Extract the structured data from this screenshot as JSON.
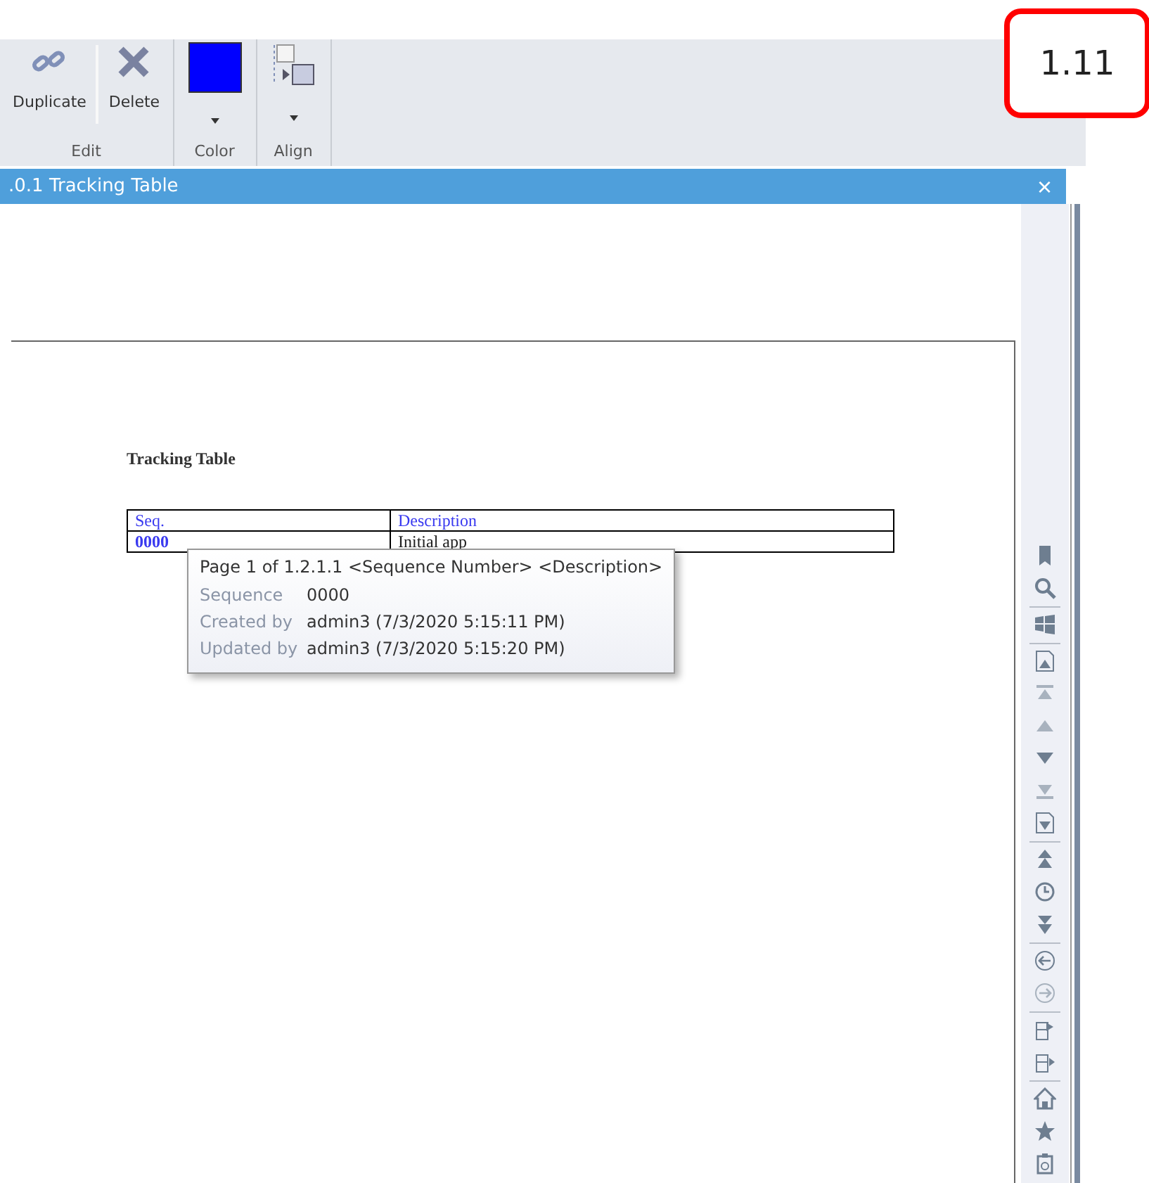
{
  "ribbon": {
    "groups": [
      {
        "kind": "buttons",
        "label": "Edit",
        "buttons": [
          {
            "label": "Duplicate"
          },
          {
            "label": "Delete"
          }
        ]
      },
      {
        "kind": "color",
        "label": "Color",
        "color": "#0000ff"
      },
      {
        "kind": "align",
        "label": "Align"
      }
    ]
  },
  "version_badge": "1.11",
  "document_tab": {
    "title": ".0.1 Tracking Table",
    "close": "×"
  },
  "document": {
    "heading": "Tracking Table",
    "columns": [
      "Seq.",
      "Description"
    ],
    "rows": [
      [
        "0000",
        "Initial app"
      ]
    ]
  },
  "tooltip": {
    "title": "Page 1 of 1.2.1.1 <Sequence Number> <Description>",
    "fields": [
      {
        "label": "Sequence",
        "value": "0000"
      },
      {
        "label": "Created by",
        "value": "admin3 (7/3/2020 5:15:11 PM)"
      },
      {
        "label": "Updated by",
        "value": "admin3 (7/3/2020 5:15:20 PM)"
      }
    ]
  },
  "side_toolbar": {
    "groups": [
      {
        "tools": [
          {
            "disabled": false
          },
          {
            "disabled": false
          }
        ]
      },
      {
        "tools": [
          {
            "disabled": false
          }
        ]
      },
      {
        "tools": [
          {
            "disabled": false
          },
          {
            "disabled": true
          },
          {
            "disabled": true
          },
          {
            "disabled": false
          },
          {
            "disabled": true
          },
          {
            "disabled": false
          }
        ]
      },
      {
        "tools": [
          {
            "disabled": false
          },
          {
            "disabled": false
          },
          {
            "disabled": false
          }
        ]
      },
      {
        "tools": [
          {
            "disabled": false
          },
          {
            "disabled": true
          }
        ]
      },
      {
        "tools": [
          {
            "disabled": false
          },
          {
            "disabled": false
          }
        ]
      },
      {
        "tools": [
          {
            "disabled": false
          },
          {
            "disabled": false
          },
          {
            "disabled": false
          }
        ]
      }
    ]
  }
}
